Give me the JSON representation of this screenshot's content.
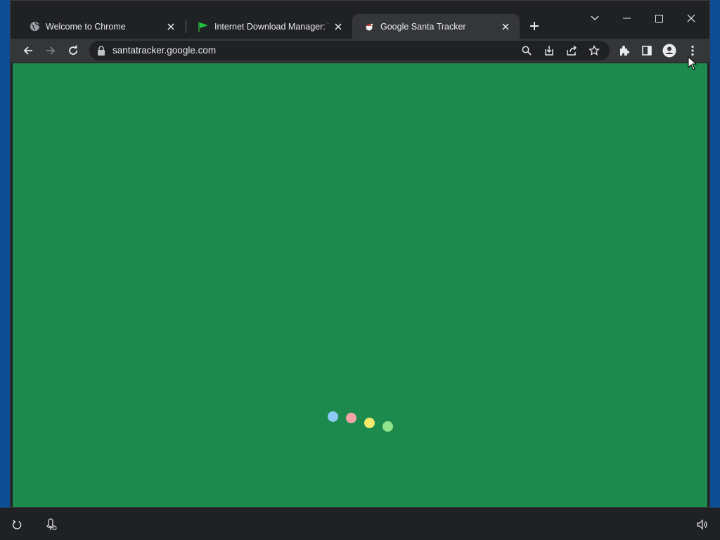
{
  "tabs": [
    {
      "title": "Welcome to Chrome",
      "icon": "globe-icon",
      "active": false
    },
    {
      "title": "Internet Download Manager: The",
      "icon": "green-flag-icon",
      "active": false
    },
    {
      "title": "Google Santa Tracker",
      "icon": "santa-icon",
      "active": true
    }
  ],
  "new_tab_label": "+",
  "omnibox": {
    "url": "santatracker.google.com"
  },
  "page": {
    "background_color": "#1c8a4c",
    "loading_dot_colors": [
      "#8ecbf7",
      "#f4a4a6",
      "#f3ea6c",
      "#92e38e"
    ]
  },
  "colors": {
    "frame": "#202124",
    "toolbar": "#35363a",
    "desktop": "#0e4d93"
  }
}
